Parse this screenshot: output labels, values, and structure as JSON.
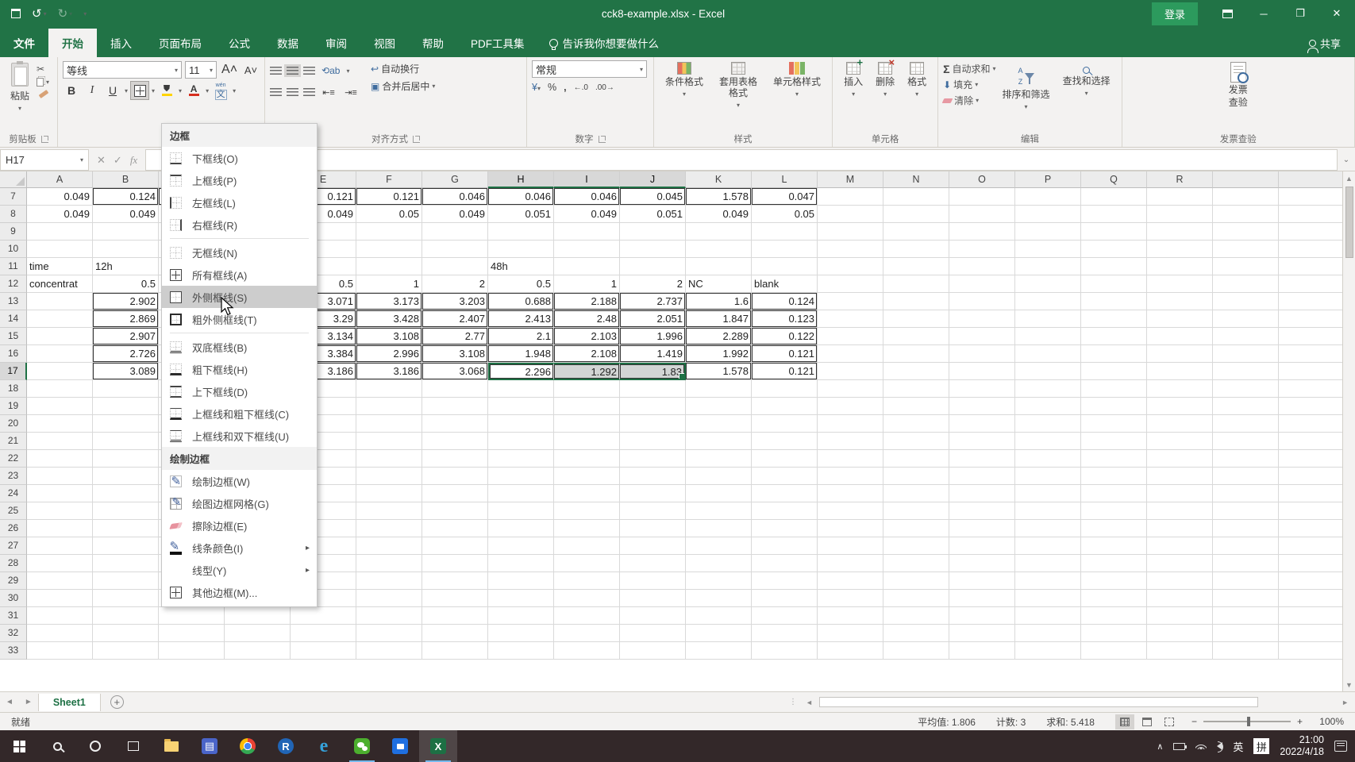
{
  "titlebar": {
    "title": "cck8-example.xlsx  -  Excel",
    "login": "登录"
  },
  "tabs": {
    "file": "文件",
    "items": [
      "开始",
      "插入",
      "页面布局",
      "公式",
      "数据",
      "审阅",
      "视图",
      "帮助",
      "PDF工具集"
    ],
    "active": "开始",
    "tell_me": "告诉我你想要做什么",
    "share": "共享"
  },
  "ribbon": {
    "clipboard": {
      "paste": "粘贴",
      "label": "剪贴板"
    },
    "font": {
      "name": "等线",
      "size": "11",
      "bold": "B",
      "italic": "I",
      "underline": "U",
      "grow": "A",
      "shrink": "A",
      "wen": "文",
      "color_a": "A"
    },
    "alignment": {
      "wrap": "自动换行",
      "merge": "合并后居中",
      "label": "对齐方式"
    },
    "number": {
      "format": "常规",
      "percent": "%",
      "comma": ",",
      "inc_dec": "←.0",
      "dec_dec": ".00→",
      "currency": "¥",
      "label": "数字"
    },
    "styles": {
      "conditional": "条件格式",
      "table": "套用表格格式",
      "cell": "单元格样式",
      "label": "样式"
    },
    "cells": {
      "insert": "插入",
      "delete": "删除",
      "format": "格式",
      "label": "单元格"
    },
    "editing": {
      "autosum": "自动求和",
      "sigma": "Σ",
      "fill": "填充",
      "clear": "清除",
      "sort": "排序和筛选",
      "find": "查找和选择",
      "label": "编辑"
    },
    "invoice": {
      "line1": "发票",
      "line2": "查验",
      "label": "发票查验"
    }
  },
  "formula_bar": {
    "name_box": "H17",
    "cancel": "✕",
    "enter": "✓",
    "fx": "fx"
  },
  "border_menu": {
    "header": "边框",
    "items": [
      {
        "label": "下框线(O)",
        "icon": "bi bi-b",
        "icon_name": "border-bottom-icon"
      },
      {
        "label": "上框线(P)",
        "icon": "bi bi-t",
        "icon_name": "border-top-icon"
      },
      {
        "label": "左框线(L)",
        "icon": "bi bi-l",
        "icon_name": "border-left-icon"
      },
      {
        "label": "右框线(R)",
        "icon": "bi bi-r",
        "icon_name": "border-right-icon",
        "sep_after": true
      },
      {
        "label": "无框线(N)",
        "icon": "bi",
        "icon_name": "no-border-icon"
      },
      {
        "label": "所有框线(A)",
        "icon": "bi bi-all",
        "icon_name": "all-borders-icon"
      },
      {
        "label": "外侧框线(S)",
        "icon": "bi bi-outside",
        "icon_name": "outside-borders-icon",
        "highlighted": true
      },
      {
        "label": "粗外侧框线(T)",
        "icon": "bi bi-thick-outside",
        "icon_name": "thick-outside-borders-icon",
        "sep_after": true
      },
      {
        "label": "双底框线(B)",
        "icon": "bi bi-double-b",
        "icon_name": "double-bottom-border-icon"
      },
      {
        "label": "粗下框线(H)",
        "icon": "bi bi-thick-b",
        "icon_name": "thick-bottom-border-icon"
      },
      {
        "label": "上下框线(D)",
        "icon": "bi bi-tb",
        "icon_name": "top-and-bottom-border-icon"
      },
      {
        "label": "上框线和粗下框线(C)",
        "icon": "bi bi-t-thickb",
        "icon_name": "top-and-thick-bottom-border-icon"
      },
      {
        "label": "上框线和双下框线(U)",
        "icon": "bi bi-t-doubleb",
        "icon_name": "top-and-double-bottom-border-icon"
      }
    ],
    "draw_header": "绘制边框",
    "draw_items": [
      {
        "label": "绘制边框(W)",
        "icon": "di-pencil",
        "icon_name": "draw-border-icon"
      },
      {
        "label": "绘图边框网格(G)",
        "icon": "di-grid-pencil",
        "icon_name": "draw-border-grid-icon"
      },
      {
        "label": "擦除边框(E)",
        "icon": "di-eraser",
        "icon_name": "erase-border-icon"
      },
      {
        "label": "线条颜色(I)",
        "icon": "di-line-color",
        "icon_name": "line-color-icon",
        "submenu": true
      },
      {
        "label": "线型(Y)",
        "icon": "di-none",
        "icon_name": "line-style-icon",
        "submenu": true
      },
      {
        "label": "其他边框(M)...",
        "icon": "bi bi-all",
        "icon_name": "more-borders-icon"
      }
    ]
  },
  "sheet": {
    "columns": [
      "A",
      "B",
      "C",
      "D",
      "E",
      "F",
      "G",
      "H",
      "I",
      "J",
      "K",
      "L",
      "M",
      "N",
      "O",
      "P",
      "Q",
      "R",
      "",
      ""
    ],
    "first_row": 7,
    "last_row": 33,
    "cells": {
      "A7": "0.049",
      "B7": "0.124",
      "E7": "0.121",
      "F7": "0.121",
      "G7": "0.046",
      "H7": "0.046",
      "I7": "0.046",
      "J7": "0.045",
      "K7": "1.578",
      "L7": "0.047",
      "A8": "0.049",
      "B8": "0.049",
      "E8": "0.049",
      "F8": "0.05",
      "G8": "0.049",
      "H8": "0.051",
      "I8": "0.049",
      "J8": "0.051",
      "K8": "0.049",
      "L8": "0.05",
      "A11": "time",
      "B11": "12h",
      "H11": "48h",
      "A12": "concentrat",
      "B12": "0.5",
      "E12": "0.5",
      "F12": "1",
      "G12": "2",
      "H12": "0.5",
      "I12": "1",
      "J12": "2",
      "K12": "NC",
      "L12": "blank",
      "B13": "2.902",
      "E13": "3.071",
      "F13": "3.173",
      "G13": "3.203",
      "H13": "0.688",
      "I13": "2.188",
      "J13": "2.737",
      "K13": "1.6",
      "L13": "0.124",
      "B14": "2.869",
      "E14": "3.29",
      "F14": "3.428",
      "G14": "2.407",
      "H14": "2.413",
      "I14": "2.48",
      "J14": "2.051",
      "K14": "1.847",
      "L14": "0.123",
      "B15": "2.907",
      "E15": "3.134",
      "F15": "3.108",
      "G15": "2.77",
      "H15": "2.1",
      "I15": "2.103",
      "J15": "1.996",
      "K15": "2.289",
      "L15": "0.122",
      "B16": "2.726",
      "E16": "3.384",
      "F16": "2.996",
      "G16": "3.108",
      "H16": "1.948",
      "I16": "2.108",
      "J16": "1.419",
      "K16": "1.992",
      "L16": "0.121",
      "B17": "3.089",
      "E17": "3.186",
      "F17": "3.186",
      "G17": "3.068",
      "H17": "2.296",
      "I17": "1.292",
      "J17": "1.83",
      "K17": "1.578",
      "L17": "0.121"
    },
    "text_cells": [
      "A11",
      "B11",
      "H11",
      "A12",
      "K12",
      "L12"
    ],
    "bordered": [
      "B7",
      "C7",
      "D7",
      "E7",
      "F7",
      "G7",
      "H7",
      "I7",
      "J7",
      "K7",
      "L7",
      "B13",
      "B14",
      "B15",
      "B16",
      "B17",
      "E13",
      "F13",
      "G13",
      "H13",
      "I13",
      "J13",
      "K13",
      "L13",
      "E14",
      "F14",
      "G14",
      "H14",
      "I14",
      "J14",
      "K14",
      "L14",
      "E15",
      "F15",
      "G15",
      "H15",
      "I15",
      "J15",
      "K15",
      "L15",
      "E16",
      "F16",
      "G16",
      "H16",
      "I16",
      "J16",
      "K16",
      "L16",
      "E17",
      "F17",
      "G17",
      "H17",
      "I17",
      "J17",
      "K17",
      "L17"
    ],
    "selection": {
      "active": "H17",
      "range": [
        "H17",
        "I17",
        "J17"
      ],
      "cols": [
        "H",
        "I",
        "J"
      ],
      "row": 17
    }
  },
  "sheet_tabs": {
    "active": "Sheet1",
    "add": "+"
  },
  "status_bar": {
    "ready": "就绪",
    "average": "平均值: 1.806",
    "count": "计数: 3",
    "sum": "求和: 5.418",
    "zoom": "100%"
  },
  "taskbar": {
    "lang": "英",
    "ime": "拼",
    "time": "21:00",
    "date": "2022/4/18",
    "r_letter": "R"
  }
}
